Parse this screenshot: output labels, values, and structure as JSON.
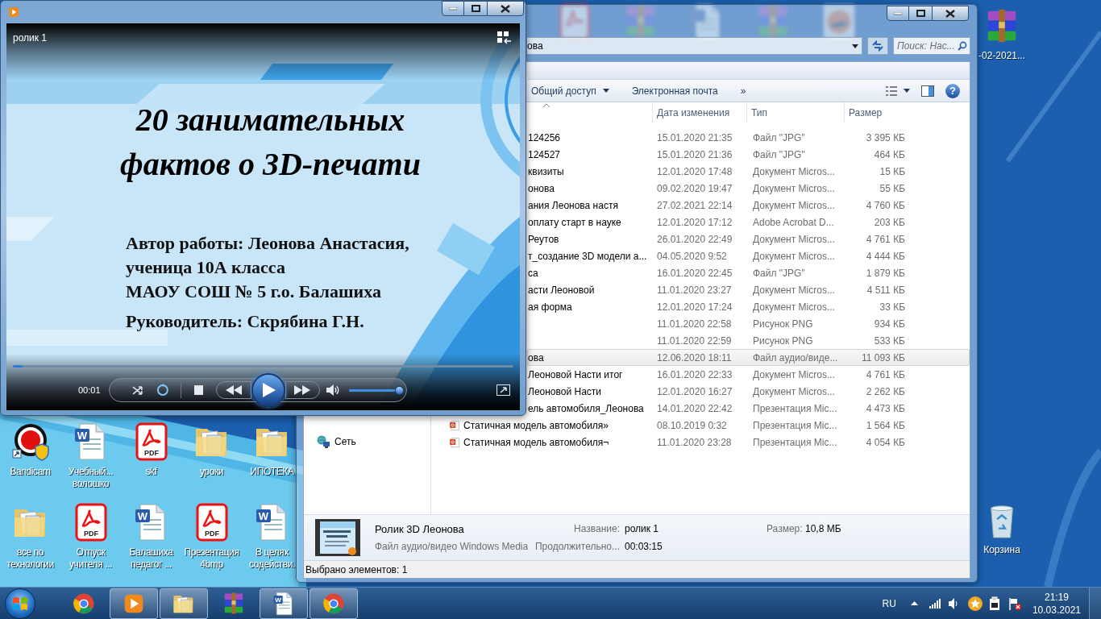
{
  "media_player": {
    "video_title": "ролик 1",
    "slide": {
      "title_lines": [
        "20 занимательных",
        "фактов о 3D-печати"
      ],
      "author_lines": [
        "Автор работы: Леонова Анастасия,",
        "ученица 10А класса",
        "МАОУ СОШ № 5 г.о. Балашиха"
      ],
      "supervisor": "Руководитель: Скрябина Г.Н."
    },
    "seek": {
      "level": 0.02
    },
    "time": "00:01",
    "playing": false,
    "volume": {
      "level": 0.93
    }
  },
  "explorer": {
    "address": "ова",
    "search": {
      "placeholder": "Поиск: Нас..."
    },
    "toolbar": [
      {
        "label": "Общий доступ",
        "kind": "menu"
      },
      {
        "label": "Электронная почта",
        "kind": "button"
      },
      {
        "label": "»",
        "kind": "button"
      }
    ],
    "help": "?",
    "columns": [
      "Дата изменения",
      "Тип",
      "Размер"
    ],
    "rows": [
      {
        "kind": "covered",
        "name": "124256",
        "date": "15.01.2020 21:35",
        "type": "Файл \"JPG\"",
        "size": "3 395 КБ",
        "selected": false
      },
      {
        "kind": "covered",
        "name": "124527",
        "date": "15.01.2020 21:36",
        "type": "Файл \"JPG\"",
        "size": "464 КБ",
        "selected": false
      },
      {
        "kind": "covered",
        "name": "квизиты",
        "date": "12.01.2020 17:48",
        "type": "Документ Micros...",
        "size": "15 КБ",
        "selected": false
      },
      {
        "kind": "covered",
        "name": "онова",
        "date": "09.02.2020 19:47",
        "type": "Документ Micros...",
        "size": "55 КБ",
        "selected": false
      },
      {
        "kind": "covered",
        "name": "ания Леонова настя",
        "date": "27.02.2021 22:14",
        "type": "Документ Micros...",
        "size": "4 760 КБ",
        "selected": false
      },
      {
        "kind": "covered",
        "name": "оплату старт в науке",
        "date": "12.01.2020 17:12",
        "type": "Adobe Acrobat D...",
        "size": "203 КБ",
        "selected": false
      },
      {
        "kind": "covered",
        "name": "Реутов",
        "date": "26.01.2020 22:49",
        "type": "Документ Micros...",
        "size": "4 761 КБ",
        "selected": false
      },
      {
        "kind": "covered",
        "name": "т_создание 3D модели а...",
        "date": "04.05.2020 9:52",
        "type": "Документ Micros...",
        "size": "4 444 КБ",
        "selected": false
      },
      {
        "kind": "covered",
        "name": "са",
        "date": "16.01.2020 22:45",
        "type": "Файл \"JPG\"",
        "size": "1 879 КБ",
        "selected": false
      },
      {
        "kind": "covered",
        "name": "асти Леоновой",
        "date": "11.01.2020 23:27",
        "type": "Документ Micros...",
        "size": "4 511 КБ",
        "selected": false
      },
      {
        "kind": "covered",
        "name": "ая форма",
        "date": "12.01.2020 17:24",
        "type": "Документ Micros...",
        "size": "33 КБ",
        "selected": false
      },
      {
        "kind": "covered",
        "date": "11.01.2020 22:58",
        "type": "Рисунок PNG",
        "size": "934 КБ",
        "selected": false
      },
      {
        "kind": "covered",
        "date": "11.01.2020 22:59",
        "type": "Рисунок PNG",
        "size": "533 КБ",
        "selected": false
      },
      {
        "kind": "covered",
        "name": "ова",
        "date": "12.06.2020 18:11",
        "type": "Файл аудио/виде...",
        "size": "11 093 КБ",
        "selected": true
      },
      {
        "kind": "covered",
        "name": "Леоновой Насти итог",
        "date": "16.01.2020 22:33",
        "type": "Документ Micros...",
        "size": "4 761 КБ",
        "selected": false
      },
      {
        "kind": "covered",
        "name": "Леоновой Насти",
        "date": "12.01.2020 16:27",
        "type": "Документ Micros...",
        "size": "2 262 КБ",
        "selected": false
      },
      {
        "kind": "covered",
        "name": "ель автомобиля_Леонова",
        "date": "14.01.2020 22:42",
        "type": "Презентация Mic...",
        "size": "4 473 КБ",
        "selected": false
      },
      {
        "kind": "presentation",
        "name": "Статичная модель автомобиля»",
        "date": "08.10.2019 0:32",
        "type": "Презентация Mic...",
        "size": "1 564 КБ",
        "selected": false
      },
      {
        "kind": "presentation",
        "name": "Статичная модель автомобиля¬",
        "date": "11.01.2020 23:28",
        "type": "Презентация Mic...",
        "size": "4 054 КБ",
        "selected": false
      }
    ],
    "nav": [
      {
        "label": "Сеть"
      }
    ],
    "details": {
      "name": "Ролик 3D Леонова",
      "type": "Файл аудио/видео Windows Media",
      "fields": [
        {
          "label": "Название:",
          "value": "ролик 1"
        },
        {
          "label": "Размер:",
          "value": "10,8 МБ"
        },
        {
          "label": "Продолжительно...",
          "value": "00:03:15"
        }
      ]
    },
    "status": "Выбрано элементов: 1"
  },
  "desktop": {
    "icons": [
      {
        "kind": "bandicam",
        "label": "Bandicam"
      },
      {
        "kind": "word",
        "label": "Учебный... волошко",
        "icon_text": "W"
      },
      {
        "kind": "pdf",
        "label": "skf",
        "icon_text": "PDF"
      },
      {
        "kind": "folder",
        "label": "уроки"
      },
      {
        "kind": "folder",
        "label": "ИПОТЕКА"
      },
      {
        "kind": "folder",
        "label": "все по технологии"
      },
      {
        "kind": "pdf",
        "label": "Отпуск учителя ...",
        "icon_text": "PDF"
      },
      {
        "kind": "word",
        "label": "Балашиха педагог ...",
        "icon_text": "W"
      },
      {
        "kind": "pdf",
        "label": "Презентация 4bmp",
        "icon_text": "PDF"
      },
      {
        "kind": "word",
        "label": "В целях содействи.",
        "icon_text": "W"
      }
    ],
    "hidden_icons": [
      {
        "kind": "pdf"
      },
      {
        "kind": "winrar"
      },
      {
        "kind": "doc"
      },
      {
        "kind": "winrar"
      },
      {
        "kind": "logo"
      }
    ],
    "right_icons": [
      {
        "kind": "winrar",
        "label": "-02-2021..."
      },
      {
        "kind": "recycle",
        "label": "Корзина"
      }
    ]
  },
  "taskbar": {
    "items": [
      {
        "kind": "chrome",
        "running": false
      },
      {
        "kind": "wmp",
        "running": true
      },
      {
        "kind": "explorer",
        "running": true
      },
      {
        "kind": "winrar",
        "running": false
      },
      {
        "kind": "word",
        "running": true,
        "icon_text": "W"
      },
      {
        "kind": "chrome",
        "running": true
      }
    ],
    "language": "RU",
    "time": "21:19",
    "date": "10.03.2021"
  }
}
